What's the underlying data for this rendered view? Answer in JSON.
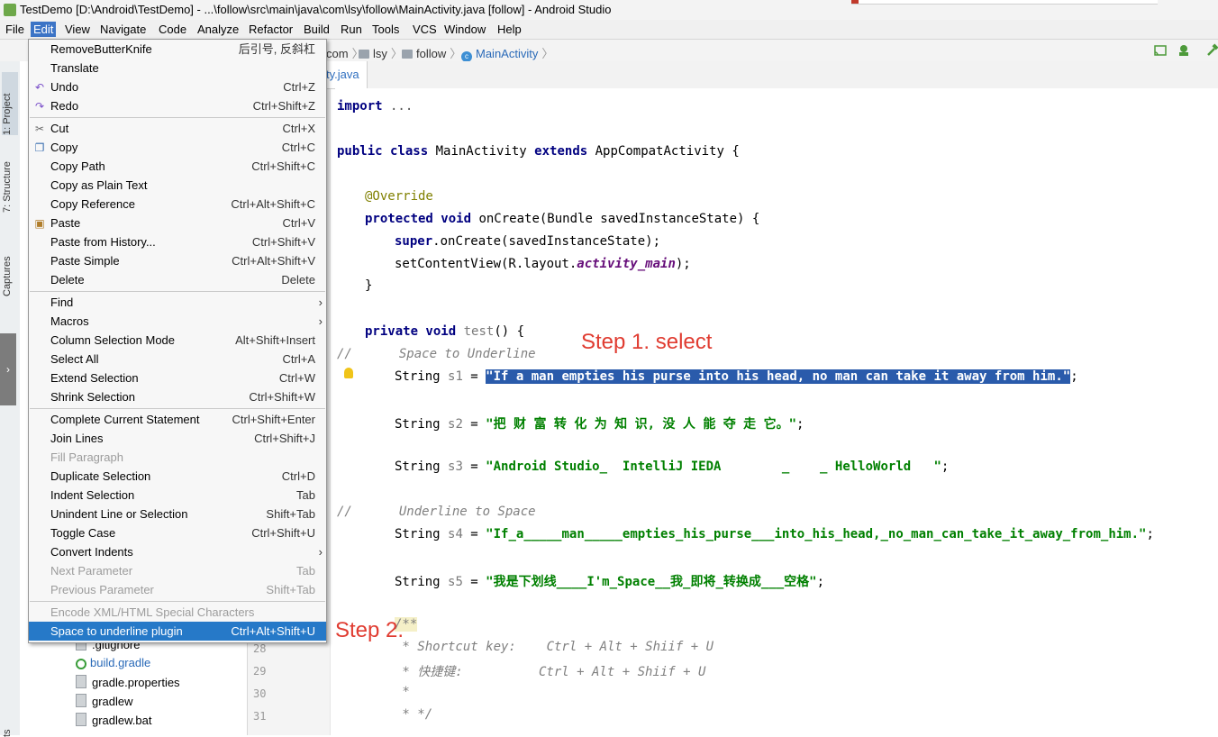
{
  "window": {
    "title": "TestDemo [D:\\Android\\TestDemo] - ...\\follow\\src\\main\\java\\com\\lsy\\follow\\MainActivity.java [follow] - Android Studio"
  },
  "menubar": [
    "File",
    "Edit",
    "View",
    "Navigate",
    "Code",
    "Analyze",
    "Refactor",
    "Build",
    "Run",
    "Tools",
    "VCS",
    "Window",
    "Help"
  ],
  "breadcrumb": {
    "c1": "com",
    "c2": "lsy",
    "c3": "follow",
    "c4": "MainActivity"
  },
  "tab": {
    "label": "ty.java"
  },
  "left_tabs": {
    "project": "1: Project",
    "structure": "7: Structure",
    "captures": "Captures",
    "z": "ts"
  },
  "edit_menu": [
    {
      "label": "RemoveButterKnife",
      "shortcut": "后引号, 反斜杠"
    },
    {
      "label": "Translate",
      "shortcut": ""
    },
    {
      "label": "Undo",
      "shortcut": "Ctrl+Z"
    },
    {
      "label": "Redo",
      "shortcut": "Ctrl+Shift+Z"
    },
    {
      "label": "Cut",
      "shortcut": "Ctrl+X"
    },
    {
      "label": "Copy",
      "shortcut": "Ctrl+C"
    },
    {
      "label": "Copy Path",
      "shortcut": "Ctrl+Shift+C"
    },
    {
      "label": "Copy as Plain Text",
      "shortcut": ""
    },
    {
      "label": "Copy Reference",
      "shortcut": "Ctrl+Alt+Shift+C"
    },
    {
      "label": "Paste",
      "shortcut": "Ctrl+V"
    },
    {
      "label": "Paste from History...",
      "shortcut": "Ctrl+Shift+V"
    },
    {
      "label": "Paste Simple",
      "shortcut": "Ctrl+Alt+Shift+V"
    },
    {
      "label": "Delete",
      "shortcut": "Delete"
    },
    {
      "label": "Find",
      "shortcut": ""
    },
    {
      "label": "Macros",
      "shortcut": ""
    },
    {
      "label": "Column Selection Mode",
      "shortcut": "Alt+Shift+Insert"
    },
    {
      "label": "Select All",
      "shortcut": "Ctrl+A"
    },
    {
      "label": "Extend Selection",
      "shortcut": "Ctrl+W"
    },
    {
      "label": "Shrink Selection",
      "shortcut": "Ctrl+Shift+W"
    },
    {
      "label": "Complete Current Statement",
      "shortcut": "Ctrl+Shift+Enter"
    },
    {
      "label": "Join Lines",
      "shortcut": "Ctrl+Shift+J"
    },
    {
      "label": "Fill Paragraph",
      "shortcut": ""
    },
    {
      "label": "Duplicate Selection",
      "shortcut": "Ctrl+D"
    },
    {
      "label": "Indent Selection",
      "shortcut": "Tab"
    },
    {
      "label": "Unindent Line or Selection",
      "shortcut": "Shift+Tab"
    },
    {
      "label": "Toggle Case",
      "shortcut": "Ctrl+Shift+U"
    },
    {
      "label": "Convert Indents",
      "shortcut": ""
    },
    {
      "label": "Next Parameter",
      "shortcut": "Tab"
    },
    {
      "label": "Previous Parameter",
      "shortcut": "Shift+Tab"
    },
    {
      "label": "Encode XML/HTML Special Characters",
      "shortcut": ""
    },
    {
      "label": "Space to underline plugin",
      "shortcut": "Ctrl+Alt+Shift+U"
    }
  ],
  "project_tree": [
    ".gitignore",
    "build.gradle",
    "gradle.properties",
    "gradlew",
    "gradlew.bat"
  ],
  "line_numbers": [
    "28",
    "29",
    "30",
    "31"
  ],
  "code": {
    "l1_kw": "import",
    "l1_rest": " ...",
    "l2_a": "public class",
    "l2_b": " MainActivity ",
    "l2_c": "extends",
    "l2_d": " AppCompatActivity {",
    "l3": "@Override",
    "l4_a": "protected void",
    "l4_b": " onCreate(Bundle savedInstanceState) {",
    "l5_a": "super",
    "l5_b": ".onCreate(savedInstanceState);",
    "l6_a": "setContentView(R.layout.",
    "l6_b": "activity_main",
    "l6_c": ");",
    "l7": "}",
    "l8_a": "private void",
    "l8_b": " test",
    "l8_c": "() {",
    "c1_slash": "//",
    "c1_text": "Space to Underline",
    "s1_a": "String ",
    "s1_v": "s1",
    "s1_eq": " = ",
    "s1_str": "\"If a man empties his purse into his head, no man can take it away from him.\"",
    "s1_end": ";",
    "s2_a": "String ",
    "s2_v": "s2",
    "s2_eq": " = ",
    "s2_str": "\"把 财 富 转 化 为 知 识, 没 人 能 夺 走 它。\"",
    "s2_end": ";",
    "s3_a": "String ",
    "s3_v": "s3",
    "s3_eq": " = ",
    "s3_str": "\"Android Studio_  IntelliJ IEDA        _    _ HelloWorld   \"",
    "s3_end": ";",
    "c2_slash": "//",
    "c2_text": "Underline to Space",
    "s4_a": "String ",
    "s4_v": "s4",
    "s4_eq": " = ",
    "s4_str": "\"If_a_____man_____empties_his_purse___into_his_head,_no_man_can_take_it_away_from_him.\"",
    "s4_end": ";",
    "s5_a": "String ",
    "s5_v": "s5",
    "s5_eq": " = ",
    "s5_str": "\"我是下划线____I'm_Space__我_即将_转换成___空格\"",
    "s5_end": ";",
    "d1": "/**",
    "d2": " * Shortcut key:    Ctrl + Alt + Shiif + U",
    "d3": " * 快捷键:          Ctrl + Alt + Shiif + U",
    "d4": " *",
    "d5": " * */"
  },
  "annotations": {
    "step1": "Step 1. select",
    "step2": "Step 2."
  }
}
